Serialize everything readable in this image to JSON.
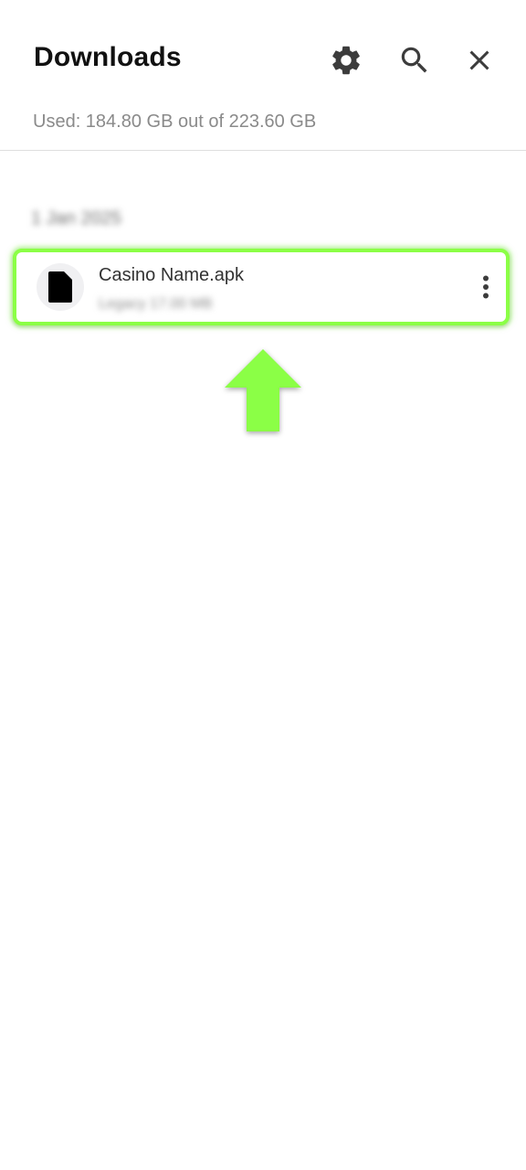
{
  "header": {
    "title": "Downloads",
    "icons": [
      "gear-icon",
      "search-icon",
      "close-icon"
    ]
  },
  "storage": {
    "text": "Used: 184.80 GB out of 223.60 GB"
  },
  "downloads": {
    "date_heading": "1 Jan 2025",
    "items": [
      {
        "name": "Casino Name.apk",
        "meta": "Legacy 17.00 MB",
        "icon": "file-icon"
      }
    ]
  },
  "colors": {
    "highlight": "#8bff46",
    "arrow": "#8bff46",
    "secondary_text": "#8a8a8a"
  }
}
